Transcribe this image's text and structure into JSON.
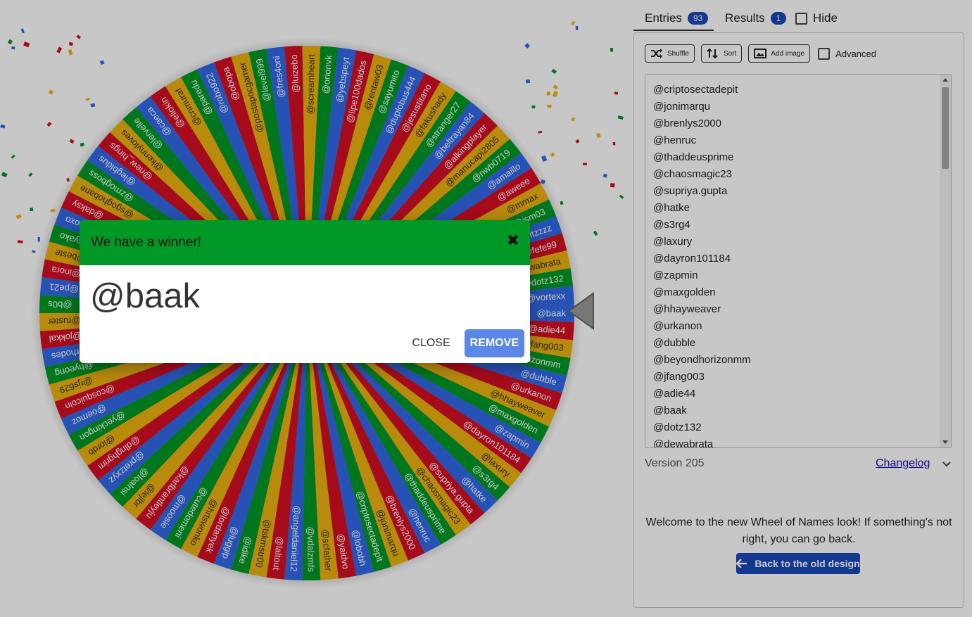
{
  "tabs": {
    "entries_label": "Entries",
    "entries_count": "93",
    "results_label": "Results",
    "results_count": "1",
    "hide_label": "Hide"
  },
  "toolbar": {
    "shuffle_label": "Shuffle",
    "sort_label": "Sort",
    "add_image_label": "Add image",
    "advanced_label": "Advanced"
  },
  "entries_list": [
    "@criptosectadepit",
    "@jonimarqu",
    "@brenlys2000",
    "@henruc",
    "@thaddeusprime",
    "@chaosmagic23",
    "@supriya.gupta",
    "@hatke",
    "@s3rg4",
    "@laxury",
    "@dayron101184",
    "@zapmin",
    "@maxgolden",
    "@hhayweaver",
    "@urkanon",
    "@dubble",
    "@beyondhorizonmm",
    "@jfang003",
    "@adie44",
    "@baak",
    "@dotz132",
    "@dewabrata"
  ],
  "version_text": "Version 205",
  "changelog_label": "Changelog",
  "welcome_text": "Welcome to the new Wheel of Names look! If something's not right, you can go back.",
  "back_button_label": "Back to the old design",
  "dialog": {
    "title": "We have a winner!",
    "winner": "@baak",
    "close_label": "CLOSE",
    "remove_label": "REMOVE"
  },
  "wheel": {
    "segment_colors": [
      "#3369e8",
      "#d50f25",
      "#eeb211",
      "#009925"
    ],
    "labels_visible": [
      "@baak",
      "@adie44",
      "@jfang003",
      "@beyondhorizonmm",
      "@dubble",
      "@urkanon",
      "@hhayweaver",
      "@maxgolden",
      "@zapmin",
      "@dayron101184",
      "@laxury",
      "@s3rg4",
      "@hatke",
      "@supriya.gupta",
      "@chaosmagic23",
      "@thaddeusprime",
      "@henruc",
      "@brenlys2000",
      "@jonimarqu",
      "@criptosectadepit",
      "@lobobh",
      "@yaidvo",
      "@scfather",
      "@vdalzmfs",
      "@angeldaniel12",
      "@laltout",
      "@tskmstr00",
      "@idlke",
      "@luggip",
      "@lordanyek",
      "@hrtswonko",
      "@cutedomeni",
      "@moosie",
      "@karlbrantleyju",
      "@lejlbr",
      "@loalnsi",
      "@pretzxyz",
      "@dlnghgrim",
      "@lordb",
      "@yeckingon",
      "@oemoz",
      "@cosquicoin",
      "@rjs629",
      "@hyeong",
      "@rhodes",
      "@jokkal",
      "@ruster",
      "@b0s",
      "@pe21",
      "@inora",
      "@beste",
      "@syako",
      "@asoxoxo",
      "@daksy",
      "@sgoghobane",
      "@zmogboss",
      "@legbldus",
      "@new_hings",
      "@kennyloves",
      "@lervelle",
      "@caeca",
      "@eliokin",
      "@cnmuraf",
      "@paredu",
      "@robo922",
      "@obopa",
      "@postapocgamer",
      "@level999",
      "@fres4oni",
      "@luizebo",
      "@screamheart",
      "@orionvk",
      "@yebspeyt",
      "@lipe100dados",
      "@rentaw03",
      "@sayumito",
      "@duplobus444",
      "@jesustitano",
      "@fakushady",
      "@stranger27",
      "@beltrayan84",
      "@alkingplayer",
      "@manucapi2805",
      "@nwb0719",
      "@amaillo",
      "@aweee",
      "@mmax",
      "@ism03",
      "@ltzzzz",
      "@fefe99",
      "@dewabrata",
      "@dotz132",
      "@vortexx"
    ]
  }
}
